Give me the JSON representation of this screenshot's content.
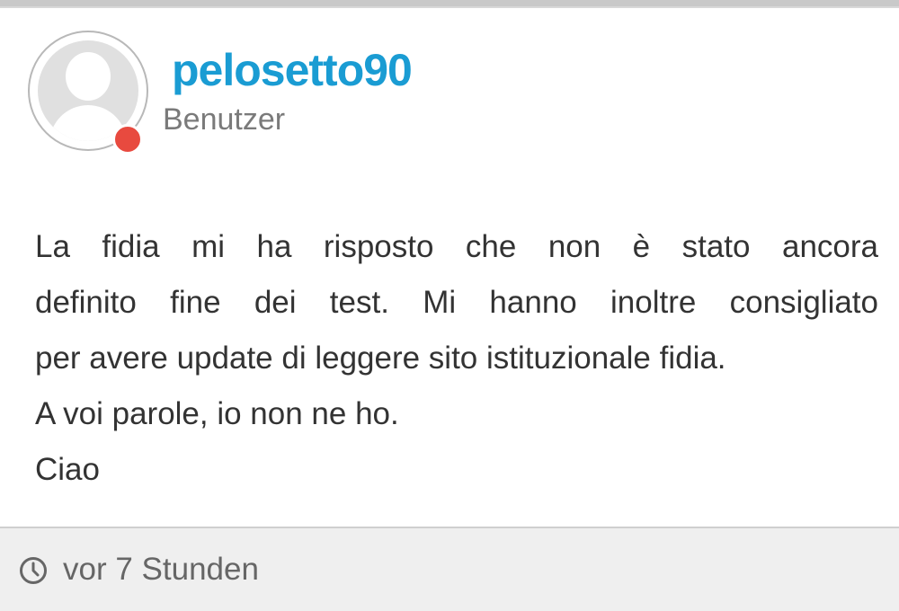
{
  "post": {
    "author": {
      "username": "pelosetto90",
      "role": "Benutzer",
      "status": "offline",
      "status_color": "#e84a3f",
      "avatar_icon": "user-silhouette-icon"
    },
    "message_lines": [
      "La fidia mi ha risposto che non è stato ancora",
      "definito fine dei test. Mi hanno inoltre consigliato",
      "per avere update di leggere sito istituzionale fidia.",
      "A voi parole, io non ne ho.",
      "Ciao"
    ],
    "footer": {
      "time_icon": "clock-icon",
      "timestamp": "vor 7 Stunden"
    }
  },
  "colors": {
    "username": "#1a9cd3",
    "role": "#7a7a7a",
    "text": "#333333",
    "footer_bg": "#efefef"
  }
}
